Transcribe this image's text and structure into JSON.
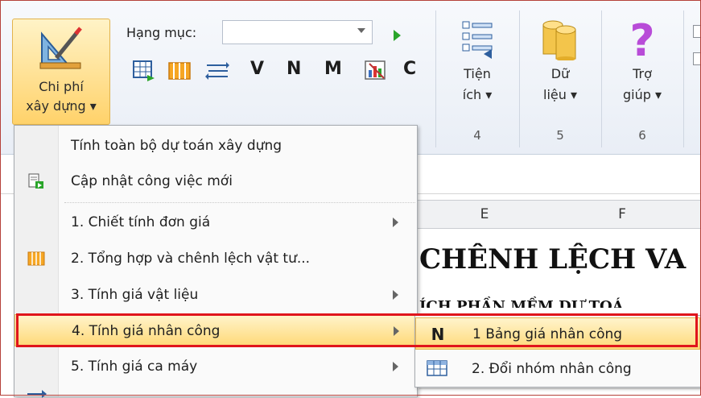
{
  "ribbon": {
    "chi_phi": {
      "label_1": "Chi phí",
      "label_2": "xây dựng ▾"
    },
    "hang_muc_label": "Hạng mục:",
    "hang_muc_value": "",
    "toolbar_letters": [
      "V",
      "N",
      "M",
      "C"
    ],
    "groups": [
      {
        "l1": "Tiện",
        "l2": "ích ▾",
        "num": "4"
      },
      {
        "l1": "Dữ",
        "l2": "liệu ▾",
        "num": "5"
      },
      {
        "l1": "Trợ",
        "l2": "giúp ▾",
        "num": "6"
      }
    ]
  },
  "sheet": {
    "columns": [
      "E",
      "F"
    ],
    "title": "CHÊNH LỆCH VA",
    "subtitle": "ÍCH PHẦN MỀM DỰ TOÁ"
  },
  "menu": {
    "items": [
      "Tính toàn bộ dự toán xây dựng",
      "Cập nhật công việc mới",
      "1. Chiết tính đơn giá",
      "2. Tổng hợp và chênh lệch vật tư...",
      "3. Tính giá vật liệu",
      "4. Tính giá nhân công",
      "5. Tính giá ca máy"
    ]
  },
  "submenu": {
    "items": [
      "1 Bảng giá nhân công",
      "2. Đổi nhóm nhân công"
    ],
    "n_letter": "N"
  },
  "colors": {
    "highlight": "#ffd978",
    "red_annotation": "#e0151c",
    "green_play": "#2aa52a"
  }
}
